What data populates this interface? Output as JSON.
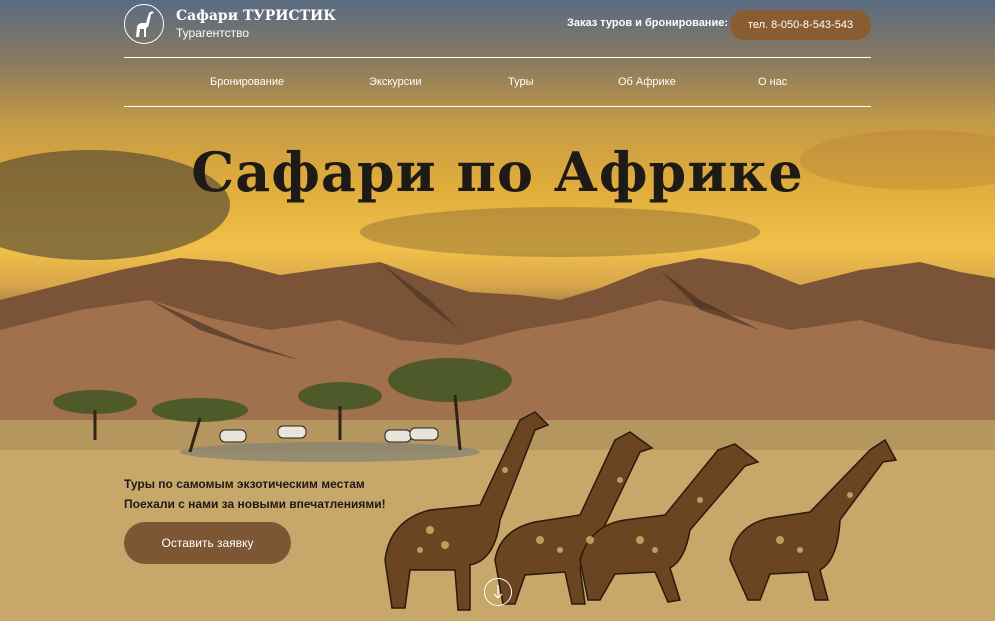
{
  "header": {
    "logo_title": "Сафари ТУРИСТИК",
    "logo_subtitle": "Турагентство",
    "logo_icon": "giraffe-icon",
    "order_label": "Заказ туров и бронирование:",
    "phone": "тел. 8-050-8-543-543"
  },
  "nav": {
    "items": [
      {
        "label": "Бронирование"
      },
      {
        "label": "Экскурсии"
      },
      {
        "label": "Туры"
      },
      {
        "label": "Об Африке"
      },
      {
        "label": "О нас"
      }
    ]
  },
  "hero": {
    "title": "Сафари по Африке",
    "tagline_line1": "Туры по самомым экзотическим местам",
    "tagline_line2": "Поехали с нами за новыми впечатлениями!",
    "cta_label": "Оставить заявку",
    "scroll_icon": "arrow-down-icon"
  },
  "colors": {
    "accent": "#8a5c32",
    "button": "#7d5733",
    "title": "#1e1a16"
  }
}
